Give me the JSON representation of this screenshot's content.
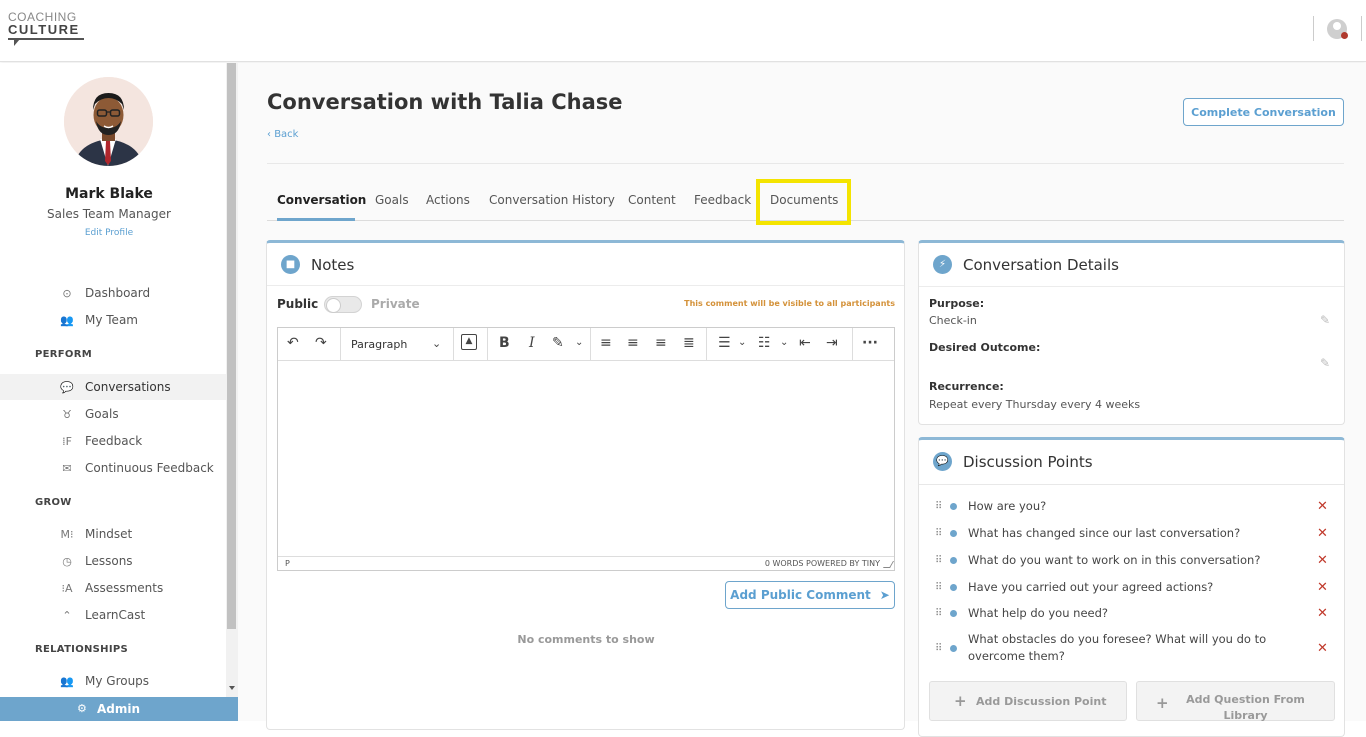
{
  "logo": {
    "line1": "COACHING",
    "line2": "CULTURE"
  },
  "profile": {
    "name": "Mark Blake",
    "role": "Sales Team Manager",
    "edit": "Edit Profile"
  },
  "nav": {
    "top": [
      {
        "label": "Dashboard",
        "icon": "⊙"
      },
      {
        "label": "My Team",
        "icon": "👥"
      }
    ],
    "perform_title": "PERFORM",
    "perform": [
      {
        "label": "Conversations",
        "icon": "💬"
      },
      {
        "label": "Goals",
        "icon": "♉"
      },
      {
        "label": "Feedback",
        "icon": "⁞F"
      },
      {
        "label": "Continuous Feedback",
        "icon": "✉"
      }
    ],
    "grow_title": "GROW",
    "grow": [
      {
        "label": "Mindset",
        "icon": "M⁝"
      },
      {
        "label": "Lessons",
        "icon": "◷"
      },
      {
        "label": "Assessments",
        "icon": "⁝A"
      },
      {
        "label": "LearnCast",
        "icon": "⌃"
      }
    ],
    "relationships_title": "RELATIONSHIPS",
    "relationships": [
      {
        "label": "My Groups",
        "icon": "👥"
      }
    ],
    "admin": {
      "label": "Admin",
      "icon": "⚙"
    }
  },
  "page": {
    "title": "Conversation with Talia Chase",
    "back": "Back",
    "complete_button": "Complete Conversation"
  },
  "tabs": [
    "Conversation",
    "Goals",
    "Actions",
    "Conversation History",
    "Content",
    "Feedback",
    "Documents"
  ],
  "notes": {
    "title": "Notes",
    "public": "Public",
    "private": "Private",
    "visibility_note": "This comment will be visible to all participants",
    "paragraph": "Paragraph",
    "status_left": "P",
    "status_right": "0 WORDS  POWERED BY TINY",
    "add_comment": "Add Public Comment",
    "no_comments": "No comments to show"
  },
  "details": {
    "title": "Conversation Details",
    "purpose_label": "Purpose:",
    "purpose_value": "Check-in",
    "outcome_label": "Desired Outcome:",
    "recurrence_label": "Recurrence:",
    "recurrence_value": "Repeat every Thursday every 4 weeks"
  },
  "discussion": {
    "title": "Discussion Points",
    "items": [
      "How are you?",
      "What has changed since our last conversation?",
      "What do you want to work on in this conversation?",
      "Have you carried out your agreed actions?",
      "What help do you need?",
      "What obstacles do you foresee? What will you do to overcome them?"
    ],
    "add_point": "Add Discussion Point",
    "add_question": "Add Question From Library"
  },
  "colors": {
    "accent": "#6ea5cc",
    "highlight": "#f4e400",
    "danger": "#c0392b",
    "note": "#d4923a"
  }
}
